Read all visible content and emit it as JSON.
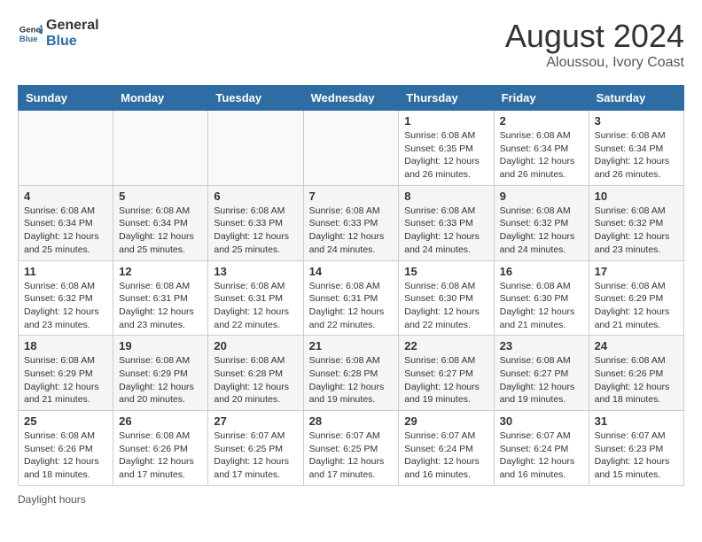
{
  "header": {
    "logo_general": "General",
    "logo_blue": "Blue",
    "month_year": "August 2024",
    "location": "Aloussou, Ivory Coast"
  },
  "days_of_week": [
    "Sunday",
    "Monday",
    "Tuesday",
    "Wednesday",
    "Thursday",
    "Friday",
    "Saturday"
  ],
  "footer": {
    "daylight_note": "Daylight hours"
  },
  "weeks": [
    {
      "days": [
        {
          "num": "",
          "info": ""
        },
        {
          "num": "",
          "info": ""
        },
        {
          "num": "",
          "info": ""
        },
        {
          "num": "",
          "info": ""
        },
        {
          "num": "1",
          "info": "Sunrise: 6:08 AM\nSunset: 6:35 PM\nDaylight: 12 hours\nand 26 minutes."
        },
        {
          "num": "2",
          "info": "Sunrise: 6:08 AM\nSunset: 6:34 PM\nDaylight: 12 hours\nand 26 minutes."
        },
        {
          "num": "3",
          "info": "Sunrise: 6:08 AM\nSunset: 6:34 PM\nDaylight: 12 hours\nand 26 minutes."
        }
      ]
    },
    {
      "days": [
        {
          "num": "4",
          "info": "Sunrise: 6:08 AM\nSunset: 6:34 PM\nDaylight: 12 hours\nand 25 minutes."
        },
        {
          "num": "5",
          "info": "Sunrise: 6:08 AM\nSunset: 6:34 PM\nDaylight: 12 hours\nand 25 minutes."
        },
        {
          "num": "6",
          "info": "Sunrise: 6:08 AM\nSunset: 6:33 PM\nDaylight: 12 hours\nand 25 minutes."
        },
        {
          "num": "7",
          "info": "Sunrise: 6:08 AM\nSunset: 6:33 PM\nDaylight: 12 hours\nand 24 minutes."
        },
        {
          "num": "8",
          "info": "Sunrise: 6:08 AM\nSunset: 6:33 PM\nDaylight: 12 hours\nand 24 minutes."
        },
        {
          "num": "9",
          "info": "Sunrise: 6:08 AM\nSunset: 6:32 PM\nDaylight: 12 hours\nand 24 minutes."
        },
        {
          "num": "10",
          "info": "Sunrise: 6:08 AM\nSunset: 6:32 PM\nDaylight: 12 hours\nand 23 minutes."
        }
      ]
    },
    {
      "days": [
        {
          "num": "11",
          "info": "Sunrise: 6:08 AM\nSunset: 6:32 PM\nDaylight: 12 hours\nand 23 minutes."
        },
        {
          "num": "12",
          "info": "Sunrise: 6:08 AM\nSunset: 6:31 PM\nDaylight: 12 hours\nand 23 minutes."
        },
        {
          "num": "13",
          "info": "Sunrise: 6:08 AM\nSunset: 6:31 PM\nDaylight: 12 hours\nand 22 minutes."
        },
        {
          "num": "14",
          "info": "Sunrise: 6:08 AM\nSunset: 6:31 PM\nDaylight: 12 hours\nand 22 minutes."
        },
        {
          "num": "15",
          "info": "Sunrise: 6:08 AM\nSunset: 6:30 PM\nDaylight: 12 hours\nand 22 minutes."
        },
        {
          "num": "16",
          "info": "Sunrise: 6:08 AM\nSunset: 6:30 PM\nDaylight: 12 hours\nand 21 minutes."
        },
        {
          "num": "17",
          "info": "Sunrise: 6:08 AM\nSunset: 6:29 PM\nDaylight: 12 hours\nand 21 minutes."
        }
      ]
    },
    {
      "days": [
        {
          "num": "18",
          "info": "Sunrise: 6:08 AM\nSunset: 6:29 PM\nDaylight: 12 hours\nand 21 minutes."
        },
        {
          "num": "19",
          "info": "Sunrise: 6:08 AM\nSunset: 6:29 PM\nDaylight: 12 hours\nand 20 minutes."
        },
        {
          "num": "20",
          "info": "Sunrise: 6:08 AM\nSunset: 6:28 PM\nDaylight: 12 hours\nand 20 minutes."
        },
        {
          "num": "21",
          "info": "Sunrise: 6:08 AM\nSunset: 6:28 PM\nDaylight: 12 hours\nand 19 minutes."
        },
        {
          "num": "22",
          "info": "Sunrise: 6:08 AM\nSunset: 6:27 PM\nDaylight: 12 hours\nand 19 minutes."
        },
        {
          "num": "23",
          "info": "Sunrise: 6:08 AM\nSunset: 6:27 PM\nDaylight: 12 hours\nand 19 minutes."
        },
        {
          "num": "24",
          "info": "Sunrise: 6:08 AM\nSunset: 6:26 PM\nDaylight: 12 hours\nand 18 minutes."
        }
      ]
    },
    {
      "days": [
        {
          "num": "25",
          "info": "Sunrise: 6:08 AM\nSunset: 6:26 PM\nDaylight: 12 hours\nand 18 minutes."
        },
        {
          "num": "26",
          "info": "Sunrise: 6:08 AM\nSunset: 6:26 PM\nDaylight: 12 hours\nand 17 minutes."
        },
        {
          "num": "27",
          "info": "Sunrise: 6:07 AM\nSunset: 6:25 PM\nDaylight: 12 hours\nand 17 minutes."
        },
        {
          "num": "28",
          "info": "Sunrise: 6:07 AM\nSunset: 6:25 PM\nDaylight: 12 hours\nand 17 minutes."
        },
        {
          "num": "29",
          "info": "Sunrise: 6:07 AM\nSunset: 6:24 PM\nDaylight: 12 hours\nand 16 minutes."
        },
        {
          "num": "30",
          "info": "Sunrise: 6:07 AM\nSunset: 6:24 PM\nDaylight: 12 hours\nand 16 minutes."
        },
        {
          "num": "31",
          "info": "Sunrise: 6:07 AM\nSunset: 6:23 PM\nDaylight: 12 hours\nand 15 minutes."
        }
      ]
    }
  ]
}
